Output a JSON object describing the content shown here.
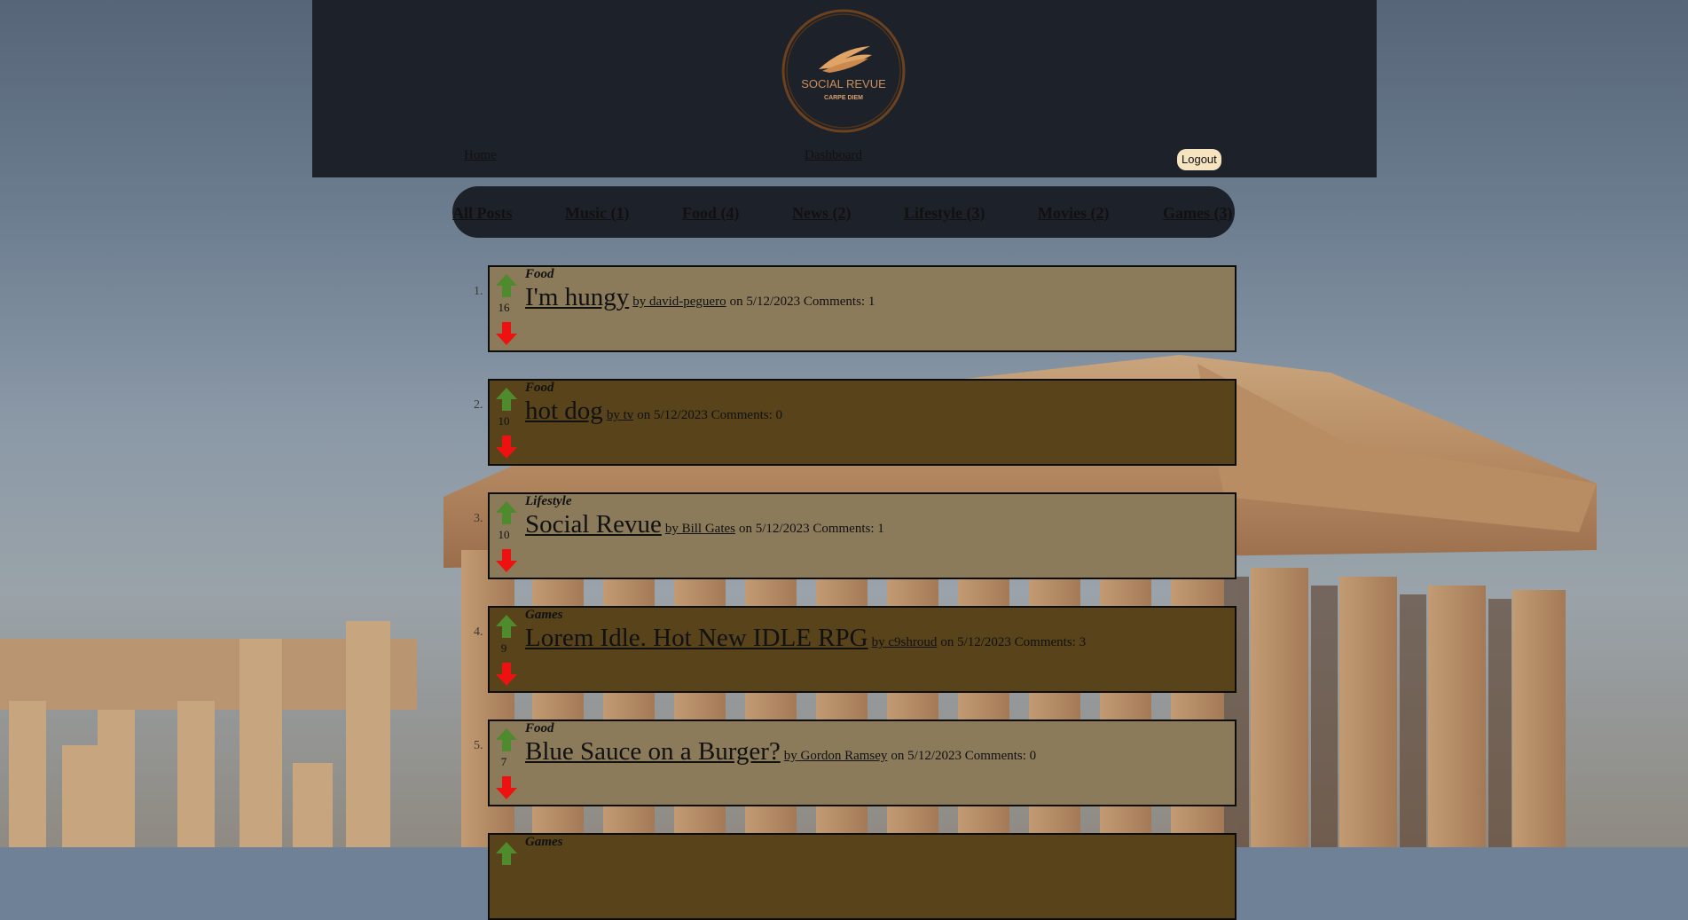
{
  "logo": {
    "name": "SOCIAL REVUE",
    "tagline": "CARPE DIEM"
  },
  "nav": {
    "home": "Home",
    "dashboard": "Dashboard",
    "logout": "Logout"
  },
  "tabs": [
    "All Posts",
    "Music (1)",
    "Food (4)",
    "News (2)",
    "Lifestyle (3)",
    "Movies (2)",
    "Games (3)"
  ],
  "posts": [
    {
      "rank": "1.",
      "category": "Food",
      "votes": "16",
      "title": "I'm hungy",
      "by": "by",
      "author": "david-peguero",
      "meta": "on 5/12/2023 Comments: 1"
    },
    {
      "rank": "2.",
      "category": "Food",
      "votes": "10",
      "title": "hot dog",
      "by": "by",
      "author": "tv",
      "meta": "on 5/12/2023 Comments: 0"
    },
    {
      "rank": "3.",
      "category": "Lifestyle",
      "votes": "10",
      "title": "Social Revue",
      "by": "by",
      "author": "Bill Gates",
      "meta": "on 5/12/2023 Comments: 1"
    },
    {
      "rank": "4.",
      "category": "Games",
      "votes": "9",
      "title": "Lorem Idle. Hot New IDLE RPG",
      "by": "by",
      "author": "c9shroud",
      "meta": "on 5/12/2023 Comments: 3"
    },
    {
      "rank": "5.",
      "category": "Food",
      "votes": "7",
      "title": "Blue Sauce on a Burger?",
      "by": "by",
      "author": "Gordon Ramsey",
      "meta": "on 5/12/2023 Comments: 0"
    },
    {
      "category": "Games"
    }
  ],
  "colors": {
    "header": "#1d2129",
    "post_light": "#8b7b5a",
    "post_dark": "#58431a",
    "upvote": "#4f8a2c",
    "downvote": "#ee1111",
    "logo_gold": "#e0a466"
  }
}
